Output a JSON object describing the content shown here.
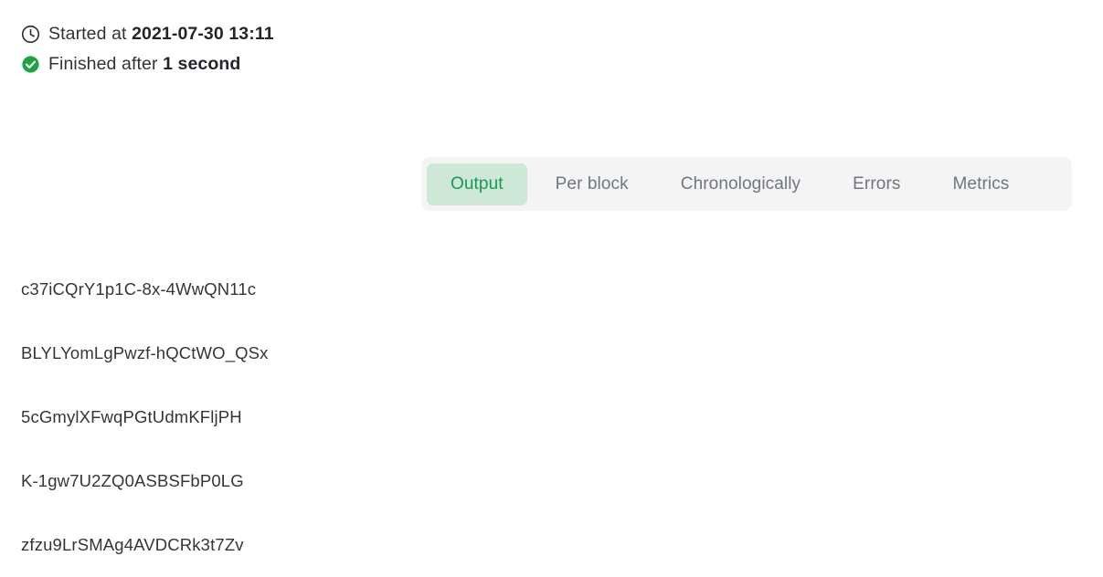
{
  "run_status": {
    "started": {
      "icon": "clock-icon",
      "label": "Started at ",
      "value": "2021-07-30 13:11"
    },
    "finished": {
      "icon": "check-circle-icon",
      "label": "Finished after ",
      "value": "1 second"
    }
  },
  "tabs": {
    "active_index": 0,
    "items": [
      {
        "label": "Output"
      },
      {
        "label": "Per block"
      },
      {
        "label": "Chronologically"
      },
      {
        "label": "Errors"
      },
      {
        "label": "Metrics"
      }
    ]
  },
  "output": {
    "lines": [
      "c37iCQrY1p1C-8x-4WwQN11c",
      "BLYLYomLgPwzf-hQCtWO_QSx",
      "5cGmylXFwqPGtUdmKFljPH",
      "K-1gw7U2ZQ0ASBSFbP0LG",
      "zfzu9LrSMAg4AVDCRk3t7Zv"
    ]
  },
  "colors": {
    "page_background": "#ffffff",
    "success_green": "#1da344",
    "tab_active_bg": "#cde8d6",
    "tab_active_text": "#169b52",
    "tab_bar_bg": "#f4f4f5",
    "tab_inactive_text": "#6f7680",
    "text_primary": "#2f3337",
    "output_text": "#333639"
  }
}
